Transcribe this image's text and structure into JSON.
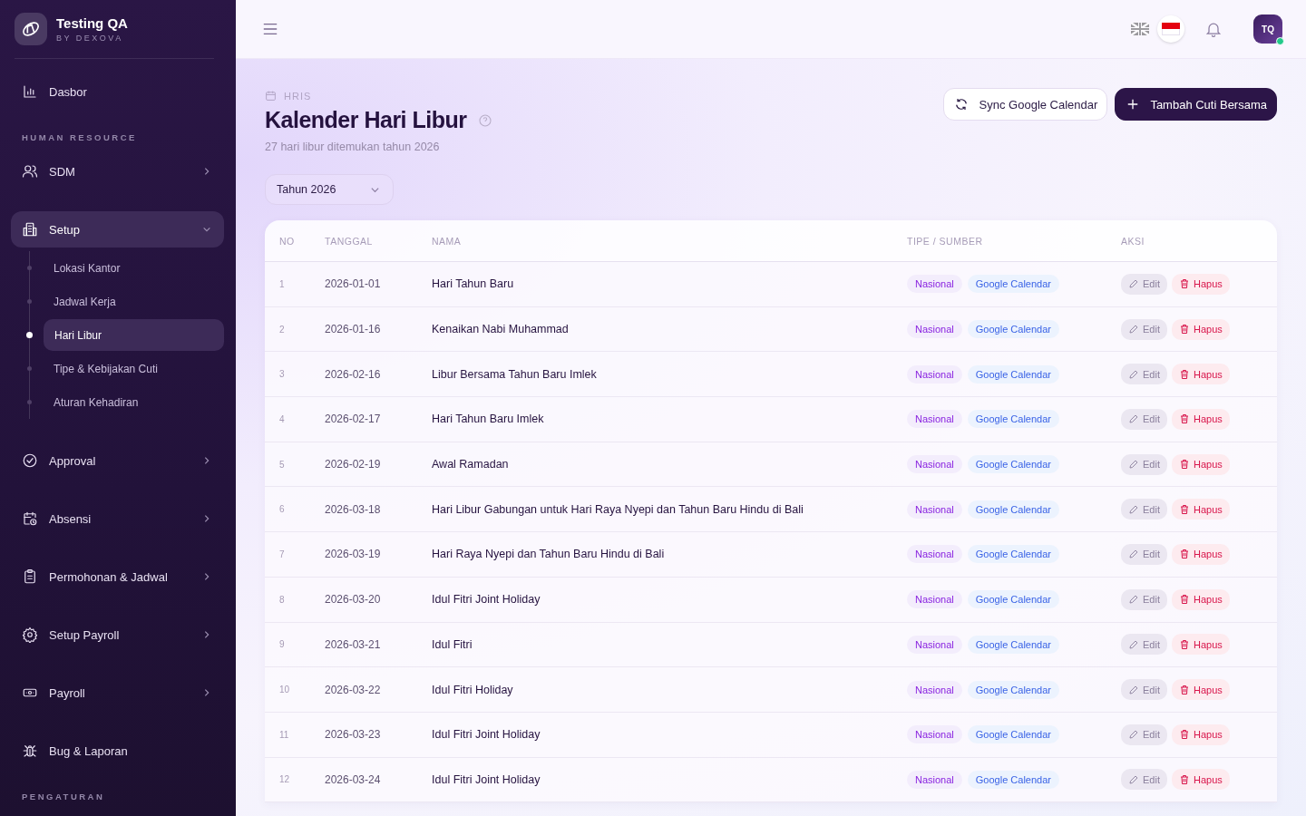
{
  "brand": {
    "name": "Testing QA",
    "tagline": "BY DEXOVA"
  },
  "nav": [
    {
      "kind": "item",
      "label": "Dasbor",
      "expandable": false,
      "selected": false
    },
    {
      "kind": "section",
      "label": "HUMAN RESOURCE"
    },
    {
      "kind": "item",
      "label": "SDM",
      "expandable": true,
      "expanded": false,
      "selected": false
    },
    {
      "kind": "item",
      "label": "Setup",
      "expandable": true,
      "expanded": true,
      "selected": true,
      "children": [
        {
          "label": "Lokasi Kantor",
          "selected": false
        },
        {
          "label": "Jadwal Kerja",
          "selected": false
        },
        {
          "label": "Hari Libur",
          "selected": true
        },
        {
          "label": "Tipe & Kebijakan Cuti",
          "selected": false
        },
        {
          "label": "Aturan Kehadiran",
          "selected": false
        }
      ]
    },
    {
      "kind": "item",
      "label": "Approval",
      "expandable": true,
      "expanded": false,
      "selected": false
    },
    {
      "kind": "item",
      "label": "Absensi",
      "expandable": true,
      "expanded": false,
      "selected": false
    },
    {
      "kind": "item",
      "label": "Permohonan & Jadwal",
      "expandable": true,
      "expanded": false,
      "selected": false
    },
    {
      "kind": "item",
      "label": "Setup Payroll",
      "expandable": true,
      "expanded": false,
      "selected": false
    },
    {
      "kind": "item",
      "label": "Payroll",
      "expandable": true,
      "expanded": false,
      "selected": false
    },
    {
      "kind": "item",
      "label": "Bug & Laporan",
      "expandable": false,
      "selected": false
    },
    {
      "kind": "section",
      "label": "PENGATURAN"
    }
  ],
  "header": {
    "languages": [
      {
        "selected": false
      },
      {
        "selected": true
      }
    ],
    "avatar": {
      "initials": "TQ",
      "online": true
    }
  },
  "page": {
    "breadcrumb": "HRIS",
    "title": "Kalender Hari Libur",
    "subtitle": "27 hari libur ditemukan tahun 2026",
    "year_select": "Tahun 2026",
    "buttons": [
      {
        "kind": "secondary",
        "label": "Sync Google Calendar"
      },
      {
        "kind": "primary",
        "label": "Tambah Cuti Bersama"
      }
    ]
  },
  "table": {
    "columns": [
      "NO",
      "TANGGAL",
      "NAMA",
      "TIPE / SUMBER",
      "AKSI"
    ],
    "rows": [
      {
        "no": "1",
        "date": "2026-01-01",
        "name": "Hari Tahun Baru",
        "type": "Nasional",
        "source": "Google Calendar",
        "edit": "Edit",
        "delete": "Hapus"
      },
      {
        "no": "2",
        "date": "2026-01-16",
        "name": "Kenaikan Nabi Muhammad",
        "type": "Nasional",
        "source": "Google Calendar",
        "edit": "Edit",
        "delete": "Hapus"
      },
      {
        "no": "3",
        "date": "2026-02-16",
        "name": "Libur Bersama Tahun Baru Imlek",
        "type": "Nasional",
        "source": "Google Calendar",
        "edit": "Edit",
        "delete": "Hapus"
      },
      {
        "no": "4",
        "date": "2026-02-17",
        "name": "Hari Tahun Baru Imlek",
        "type": "Nasional",
        "source": "Google Calendar",
        "edit": "Edit",
        "delete": "Hapus"
      },
      {
        "no": "5",
        "date": "2026-02-19",
        "name": "Awal Ramadan",
        "type": "Nasional",
        "source": "Google Calendar",
        "edit": "Edit",
        "delete": "Hapus"
      },
      {
        "no": "6",
        "date": "2026-03-18",
        "name": "Hari Libur Gabungan untuk Hari Raya Nyepi dan Tahun Baru Hindu di Bali",
        "type": "Nasional",
        "source": "Google Calendar",
        "edit": "Edit",
        "delete": "Hapus"
      },
      {
        "no": "7",
        "date": "2026-03-19",
        "name": "Hari Raya Nyepi dan Tahun Baru Hindu di Bali",
        "type": "Nasional",
        "source": "Google Calendar",
        "edit": "Edit",
        "delete": "Hapus"
      },
      {
        "no": "8",
        "date": "2026-03-20",
        "name": "Idul Fitri Joint Holiday",
        "type": "Nasional",
        "source": "Google Calendar",
        "edit": "Edit",
        "delete": "Hapus"
      },
      {
        "no": "9",
        "date": "2026-03-21",
        "name": "Idul Fitri",
        "type": "Nasional",
        "source": "Google Calendar",
        "edit": "Edit",
        "delete": "Hapus"
      },
      {
        "no": "10",
        "date": "2026-03-22",
        "name": "Idul Fitri Holiday",
        "type": "Nasional",
        "source": "Google Calendar",
        "edit": "Edit",
        "delete": "Hapus"
      },
      {
        "no": "11",
        "date": "2026-03-23",
        "name": "Idul Fitri Joint Holiday",
        "type": "Nasional",
        "source": "Google Calendar",
        "edit": "Edit",
        "delete": "Hapus"
      },
      {
        "no": "12",
        "date": "2026-03-24",
        "name": "Idul Fitri Joint Holiday",
        "type": "Nasional",
        "source": "Google Calendar",
        "edit": "Edit",
        "delete": "Hapus"
      }
    ]
  }
}
